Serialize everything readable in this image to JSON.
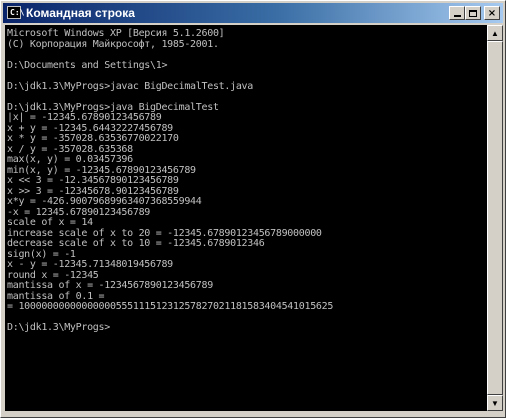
{
  "window": {
    "title": "Командная строка",
    "app_icon": "command-prompt-icon",
    "icon_text": "C:\\",
    "controls": {
      "minimize": "minimize-icon",
      "maximize": "maximize-icon",
      "close": "×"
    }
  },
  "console": {
    "text_color": "#c0c0c0",
    "background": "#000000",
    "lines": [
      "Microsoft Windows XP [Версия 5.1.2600]",
      "(С) Корпорация Майкрософт, 1985-2001.",
      "",
      "D:\\Documents and Settings\\1>",
      "",
      "D:\\jdk1.3\\MyProgs>javac BigDecimalTest.java",
      "",
      "D:\\jdk1.3\\MyProgs>java BigDecimalTest",
      "|x| = -12345.67890123456789",
      "x + y = -12345.64432227456789",
      "x * y = -357028.63536770022170",
      "x / y = -357028.635368",
      "max(x, y) = 0.03457396",
      "min(x, y) = -12345.67890123456789",
      "x << 3 = -12.34567890123456789",
      "x >> 3 = -12345678.90123456789",
      "x*y = -426.90079689963407368559944",
      "-x = 12345.67890123456789",
      "scale of x = 14",
      "increase scale of x to 20 = -12345.67890123456789000000",
      "decrease scale of x to 10 = -12345.6789012346",
      "sign(x) = -1",
      "x - y = -12345.71348019456789",
      "round x = -12345",
      "mantissa of x = -1234567890123456789",
      "mantissa of 0.1 =",
      "= 1000000000000000055511151231257827021181583404541015625",
      "",
      "D:\\jdk1.3\\MyProgs>"
    ]
  },
  "scrollbar": {
    "up": "▲",
    "down": "▼"
  }
}
